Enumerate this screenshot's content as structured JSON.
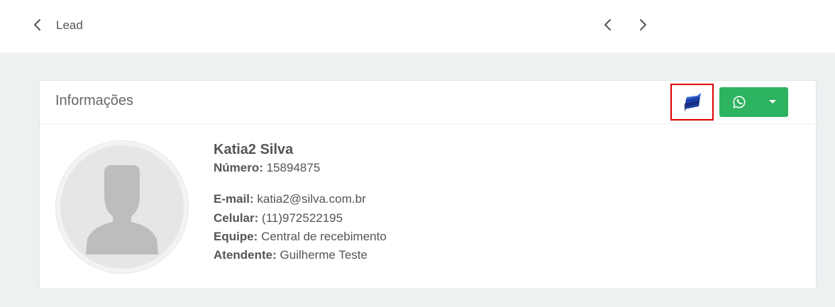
{
  "topbar": {
    "title": "Lead"
  },
  "card": {
    "title": "Informações"
  },
  "contact": {
    "name": "Katia2 Silva",
    "numero_label": "Número:",
    "numero_value": "15894875",
    "email_label": "E-mail:",
    "email_value": "katia2@silva.com.br",
    "celular_label": "Celular:",
    "celular_value": "(11)972522195",
    "equipe_label": "Equipe:",
    "equipe_value": "Central de recebimento",
    "atendente_label": "Atendente:",
    "atendente_value": "Guilherme Teste"
  },
  "icons": {
    "back": "chevron-left-icon",
    "prev": "chevron-left-icon",
    "next": "chevron-right-icon",
    "brand": "flag-logo-icon",
    "whatsapp": "whatsapp-icon",
    "caret": "caret-down-icon",
    "avatar": "person-silhouette-icon"
  },
  "colors": {
    "whatsapp_button": "#2eb360",
    "highlight_border": "#e00000",
    "brand_blue": "#1f3fa8",
    "background": "#eef1f2"
  }
}
